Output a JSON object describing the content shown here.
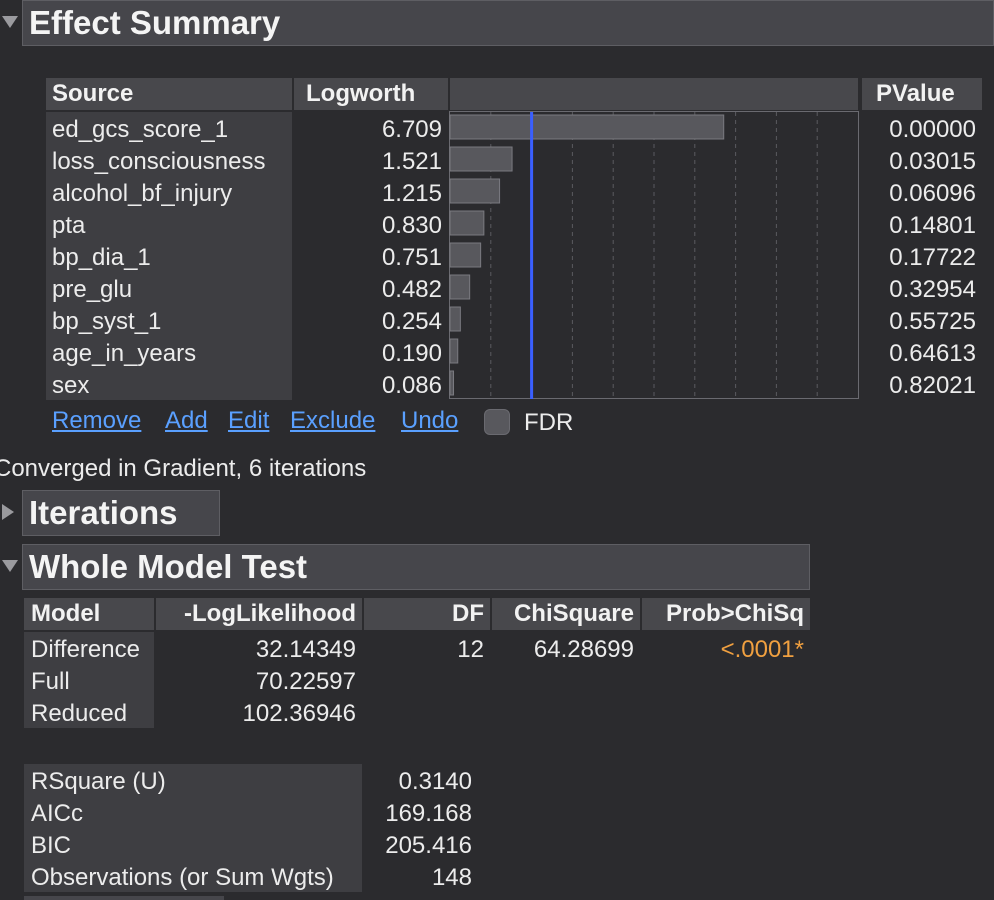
{
  "effect_summary": {
    "title": "Effect Summary",
    "headers": {
      "source": "Source",
      "logworth": "Logworth",
      "pvalue": "PValue"
    },
    "rows": [
      {
        "source": "ed_gcs_score_1",
        "logworth": "6.709",
        "pvalue": "0.00000",
        "value": 6.709
      },
      {
        "source": "loss_consciousness",
        "logworth": "1.521",
        "pvalue": "0.03015",
        "value": 1.521
      },
      {
        "source": "alcohol_bf_injury",
        "logworth": "1.215",
        "pvalue": "0.06096",
        "value": 1.215
      },
      {
        "source": "pta",
        "logworth": "0.830",
        "pvalue": "0.14801",
        "value": 0.83
      },
      {
        "source": "bp_dia_1",
        "logworth": "0.751",
        "pvalue": "0.17722",
        "value": 0.751
      },
      {
        "source": "pre_glu",
        "logworth": "0.482",
        "pvalue": "0.32954",
        "value": 0.482
      },
      {
        "source": "bp_syst_1",
        "logworth": "0.254",
        "pvalue": "0.55725",
        "value": 0.254
      },
      {
        "source": "age_in_years",
        "logworth": "0.190",
        "pvalue": "0.64613",
        "value": 0.19
      },
      {
        "source": "sex",
        "logworth": "0.086",
        "pvalue": "0.82021",
        "value": 0.086
      }
    ],
    "bar_axis_max": 10,
    "reference_line_value": 2,
    "links": {
      "remove": "Remove",
      "add": "Add",
      "edit": "Edit",
      "exclude": "Exclude",
      "undo": "Undo"
    },
    "fdr_label": "FDR"
  },
  "converged_text": "Converged in Gradient, 6 iterations",
  "iterations_title": "Iterations",
  "whole_model": {
    "title": "Whole Model Test",
    "headers": {
      "model": "Model",
      "loglik": "-LogLikelihood",
      "df": "DF",
      "chisq": "ChiSquare",
      "prob": "Prob>ChiSq"
    },
    "rows": [
      {
        "model": "Difference",
        "loglik": "32.14349",
        "df": "12",
        "chisq": "64.28699",
        "prob": "<.0001*"
      },
      {
        "model": "Full",
        "loglik": "70.22597",
        "df": "",
        "chisq": "",
        "prob": ""
      },
      {
        "model": "Reduced",
        "loglik": "102.36946",
        "df": "",
        "chisq": "",
        "prob": ""
      }
    ],
    "stats": [
      {
        "label": "RSquare (U)",
        "value": "0.3140"
      },
      {
        "label": "AICc",
        "value": "169.168"
      },
      {
        "label": "BIC",
        "value": "205.416"
      },
      {
        "label": "Observations (or Sum Wgts)",
        "value": "148"
      }
    ]
  },
  "colors": {
    "bar_fill": "#58585d",
    "bar_border": "#7a7a80",
    "ref_line": "#3a5fff",
    "significant": "#f0a040"
  }
}
